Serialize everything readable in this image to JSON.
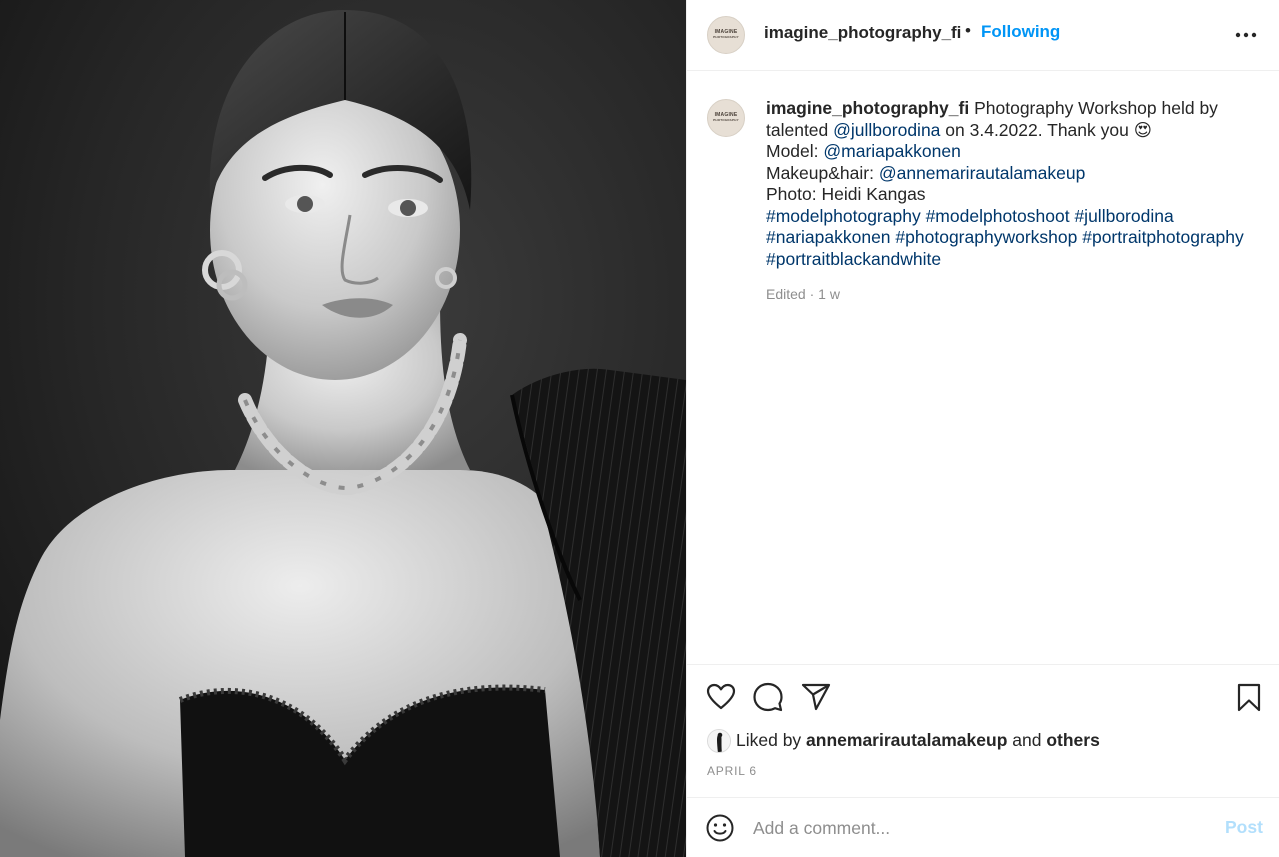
{
  "photo": {
    "description_icon": "portrait-photo"
  },
  "header": {
    "username": "imagine_photography_fi",
    "separator": "•",
    "follow_status": "Following",
    "avatar_text": "IMAGINE",
    "avatar_subtext": "PHOTOGRAPHY"
  },
  "caption": {
    "username": "imagine_photography_fi",
    "line1_text": " Photography Workshop held by",
    "line2_prefix": "talented ",
    "line2_mention": "@jullborodina",
    "line2_text": " on 3.4.2022. Thank you ",
    "line2_emoji": "😍",
    "line3_label": "Model: ",
    "line3_mention": "@mariapakkonen",
    "line4_label": "Makeup&hair: ",
    "line4_mention": "@annemarirautalamakeup",
    "line5_text": "Photo: Heidi Kangas",
    "hashtags_line1": [
      "#modelphotography",
      "#modelphotoshoot",
      "#jullborodina"
    ],
    "hashtags_line2": [
      "#nariapakkonen",
      "#photographyworkshop",
      "#portraitphotography"
    ],
    "hashtags_line3": [
      "#portraitblackandwhite"
    ],
    "meta": "Edited · 1 w"
  },
  "actions": {
    "icons": [
      "heart-icon",
      "comment-icon",
      "share-icon",
      "bookmark-icon"
    ]
  },
  "likes": {
    "prefix": "Liked by ",
    "user": "annemarirautalamakeup",
    "middle": " and ",
    "others": "others"
  },
  "date": "APRIL 6",
  "comment_box": {
    "placeholder": "Add a comment...",
    "post_label": "Post"
  },
  "colors": {
    "link": "#00376b",
    "follow": "#0095f6",
    "post_disabled": "#b2dffc",
    "muted": "#8e8e8e"
  }
}
